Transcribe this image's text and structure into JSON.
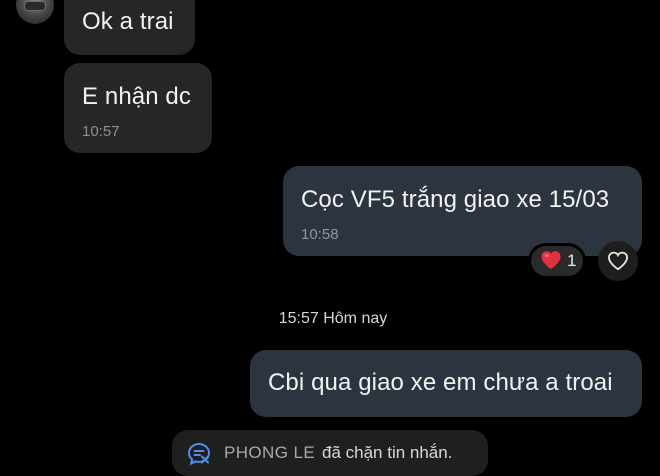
{
  "conversation": {
    "messages": [
      {
        "direction": "incoming",
        "text": "Ok a trai",
        "time": ""
      },
      {
        "direction": "incoming",
        "text": "E nhận dc",
        "time": "10:57"
      },
      {
        "direction": "outgoing",
        "text": "Cọc VF5 trắng giao xe 15/03",
        "time": "10:58",
        "reaction": {
          "emoji": "heart",
          "count": "1"
        }
      },
      {
        "direction": "outgoing",
        "text": "Cbi qua giao xe em chưa a troai",
        "time": ""
      }
    ],
    "day_separator": "15:57 Hôm nay"
  },
  "blocked_notice": {
    "name": "PHONG LE",
    "text": "đã chặn tin nhắn."
  },
  "colors": {
    "background": "#000000",
    "incoming_bubble": "#262626",
    "outgoing_bubble": "#2c3440",
    "heart": "#e0323f"
  },
  "icons": {
    "avatar": "avatar",
    "reaction": "heart-icon",
    "react_button": "heart-outline-icon",
    "blocked": "chat-blocked-icon"
  }
}
